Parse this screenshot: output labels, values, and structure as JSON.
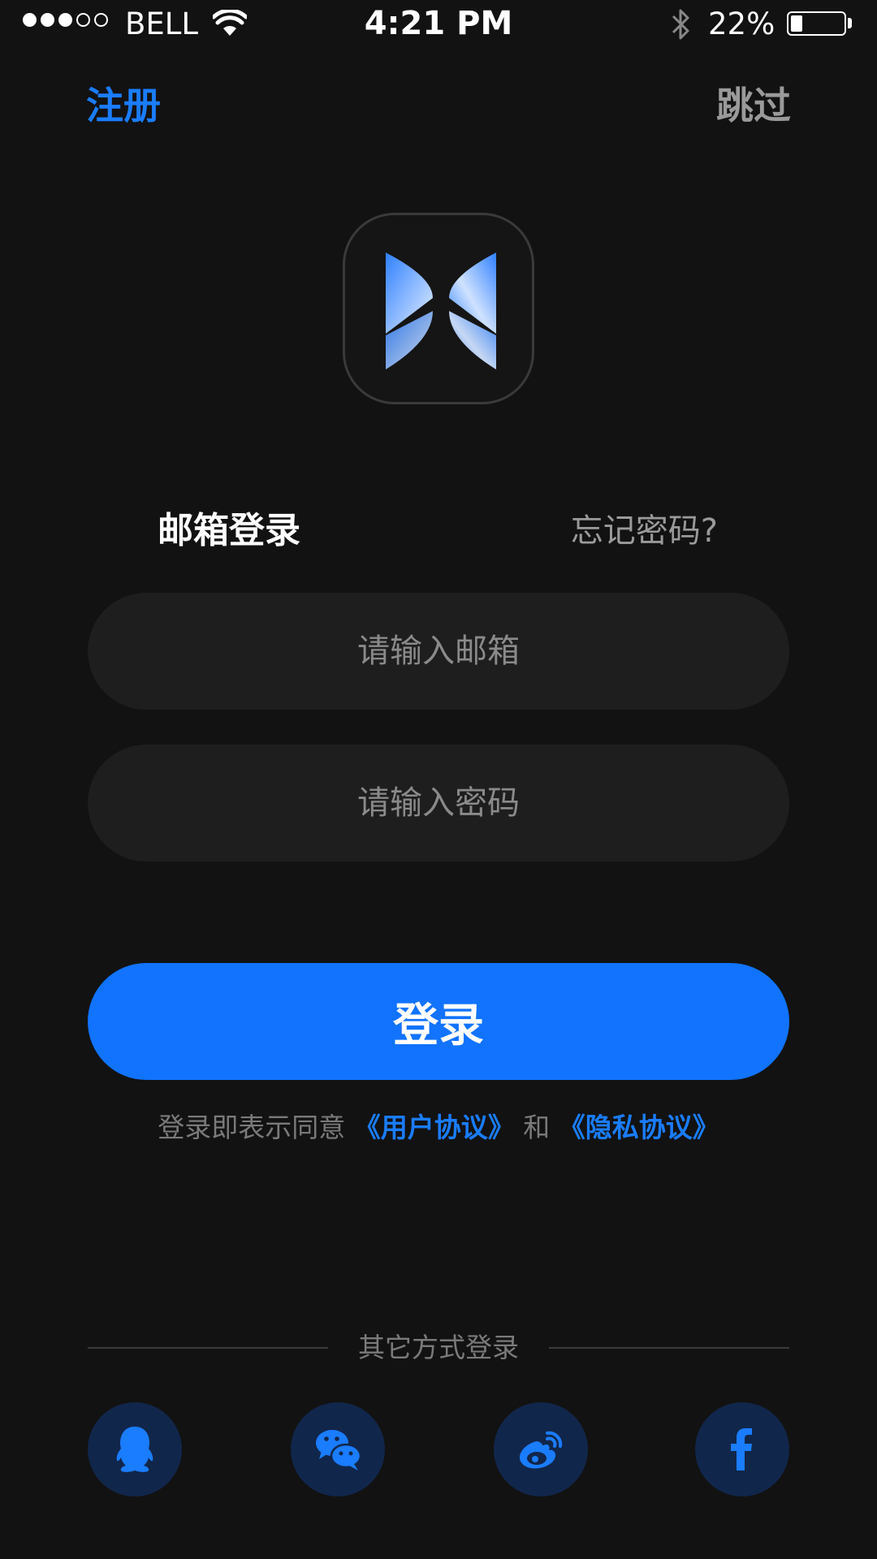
{
  "status_bar": {
    "signal_filled": 3,
    "signal_total": 5,
    "carrier": "BELL",
    "time": "4:21 PM",
    "battery_percent_label": "22%",
    "battery_level": 0.22,
    "icons": [
      "wifi-icon",
      "bluetooth-icon",
      "battery-icon"
    ]
  },
  "nav": {
    "register_label": "注册",
    "skip_label": "跳过"
  },
  "logo": {
    "icon": "app-logo-icon"
  },
  "login_mode": {
    "title": "邮箱登录",
    "forgot_label": "忘记密码?"
  },
  "form": {
    "email": {
      "value": "",
      "placeholder": "请输入邮箱"
    },
    "password": {
      "value": "",
      "placeholder": "请输入密码"
    },
    "login_button_label": "登录"
  },
  "agreement": {
    "prefix": "登录即表示同意",
    "user_agreement": "《用户协议》",
    "conjunction": "和",
    "privacy_agreement": "《隐私协议》"
  },
  "other_methods": {
    "label": "其它方式登录",
    "providers": [
      {
        "icon": "qq-icon"
      },
      {
        "icon": "wechat-icon"
      },
      {
        "icon": "weibo-icon"
      },
      {
        "icon": "facebook-icon"
      }
    ]
  },
  "colors": {
    "background": "#121212",
    "accent": "#1173ff",
    "link": "#1a7cff",
    "field_background": "#1e1e1e",
    "social_background": "#11264b"
  }
}
